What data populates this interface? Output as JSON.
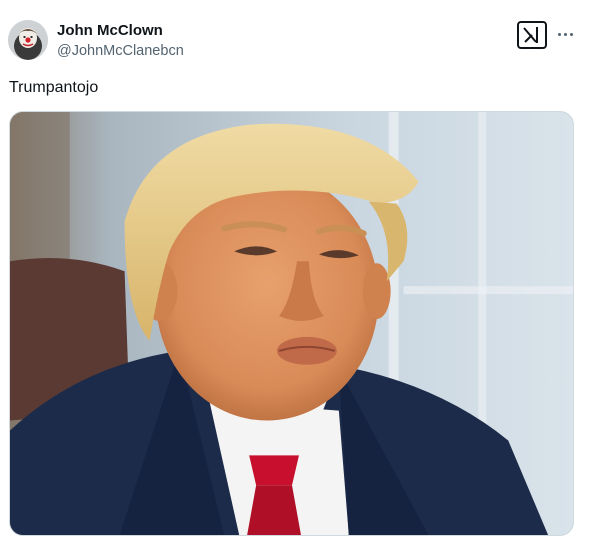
{
  "tweet": {
    "author_name": "John McClown",
    "author_handle": "@JohnMcClanebcn",
    "text": "Trumpantojo"
  },
  "icons": {
    "avatar": "clown-avatar-icon",
    "grok": "grok-x-logo-icon",
    "more": "more-options-icon"
  },
  "media": {
    "description_icon": "photo-image"
  },
  "colors": {
    "text_primary": "#0f1419",
    "text_secondary": "#536471",
    "border": "#cfd9de",
    "suit_navy": "#1d2b4a",
    "tie_red": "#c8102e",
    "hair_blonde": "#e5c77d"
  }
}
